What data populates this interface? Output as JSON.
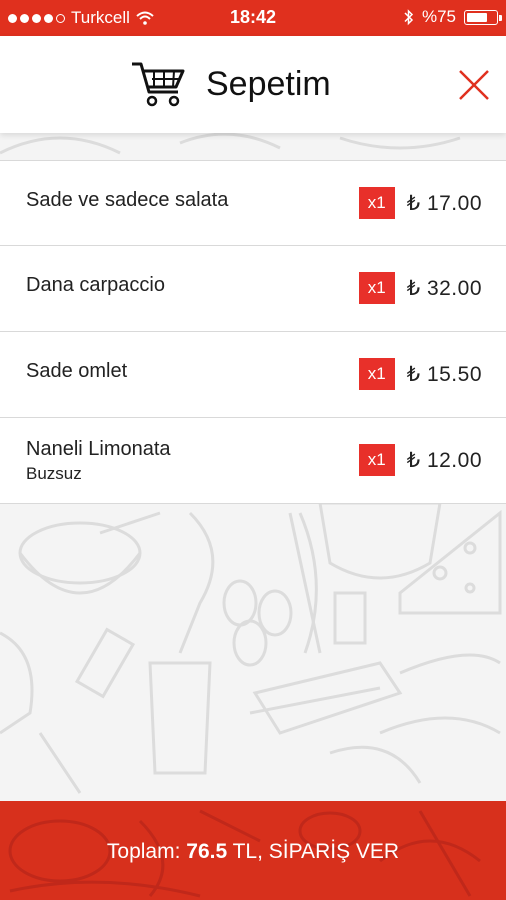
{
  "status_bar": {
    "carrier": "Turkcell",
    "time": "18:42",
    "battery": "%75",
    "battery_level": 0.75,
    "signal_bars_filled": 4,
    "signal_bars_total": 5
  },
  "header": {
    "title": "Sepetim",
    "cart_icon": "shopping-cart-icon",
    "close_icon": "close-icon"
  },
  "cart": {
    "items": [
      {
        "name": "Sade ve sadece salata",
        "note": "",
        "qty": "x1",
        "price": "₺ 17.00"
      },
      {
        "name": "Dana carpaccio",
        "note": "",
        "qty": "x1",
        "price": "₺ 32.00"
      },
      {
        "name": "Sade omlet",
        "note": "",
        "qty": "x1",
        "price": "₺ 15.50"
      },
      {
        "name": "Naneli Limonata",
        "note": "Buzsuz",
        "qty": "x1",
        "price": "₺ 12.00"
      }
    ]
  },
  "footer": {
    "prefix": "Toplam: ",
    "total": "76.5",
    "suffix": " TL, SİPARİŞ VER"
  },
  "colors": {
    "accent": "#e0301e",
    "badge": "#e8302a",
    "footer": "#d7301c"
  }
}
